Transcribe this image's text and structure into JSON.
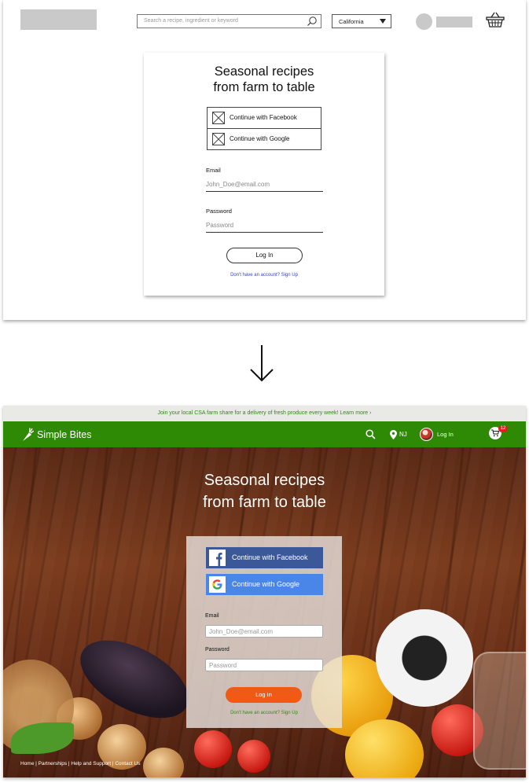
{
  "wireframe": {
    "search_placeholder": "Search a recipe, ingredient or keyword",
    "location": "California",
    "title_line1": "Seasonal recipes",
    "title_line2": "from farm to table",
    "facebook_label": "Continue with Facebook",
    "google_label": "Continue with Google",
    "email_label": "Email",
    "email_placeholder": "John_Doe@email.com",
    "password_label": "Password",
    "password_placeholder": "Password",
    "login_label": "Log In",
    "signup_text": "Don't have an account? Sign Up"
  },
  "final": {
    "promo_text": "Join your local CSA farm share for a delivery of fresh produce every week!  Learn more ›",
    "brand": "Simple Bites",
    "location": "NJ",
    "login_label": "Log In",
    "cart_count": "12",
    "title_line1": "Seasonal recipes",
    "title_line2": "from farm to table",
    "facebook_label": "Continue with Facebook",
    "google_label": "Continue with Google",
    "email_label": "Email",
    "email_placeholder": "John_Doe@email.com",
    "password_label": "Password",
    "password_placeholder": "Password",
    "submit_label": "Log In",
    "signup_text": "Don't have an account? Sign Up",
    "footer": "Home | Partnerships | Help and Support | Contact Us"
  },
  "colors": {
    "brand_green": "#2e8905",
    "accent_orange": "#f05a14",
    "facebook_blue": "#3b5998",
    "google_blue": "#4a86e8",
    "badge_red": "#e02020"
  },
  "icons": [
    "search-icon",
    "chevron-down-icon",
    "basket-icon",
    "image-placeholder-icon",
    "down-arrow-icon",
    "carrot-icon",
    "map-pin-icon",
    "cart-icon",
    "facebook-icon",
    "google-icon"
  ]
}
